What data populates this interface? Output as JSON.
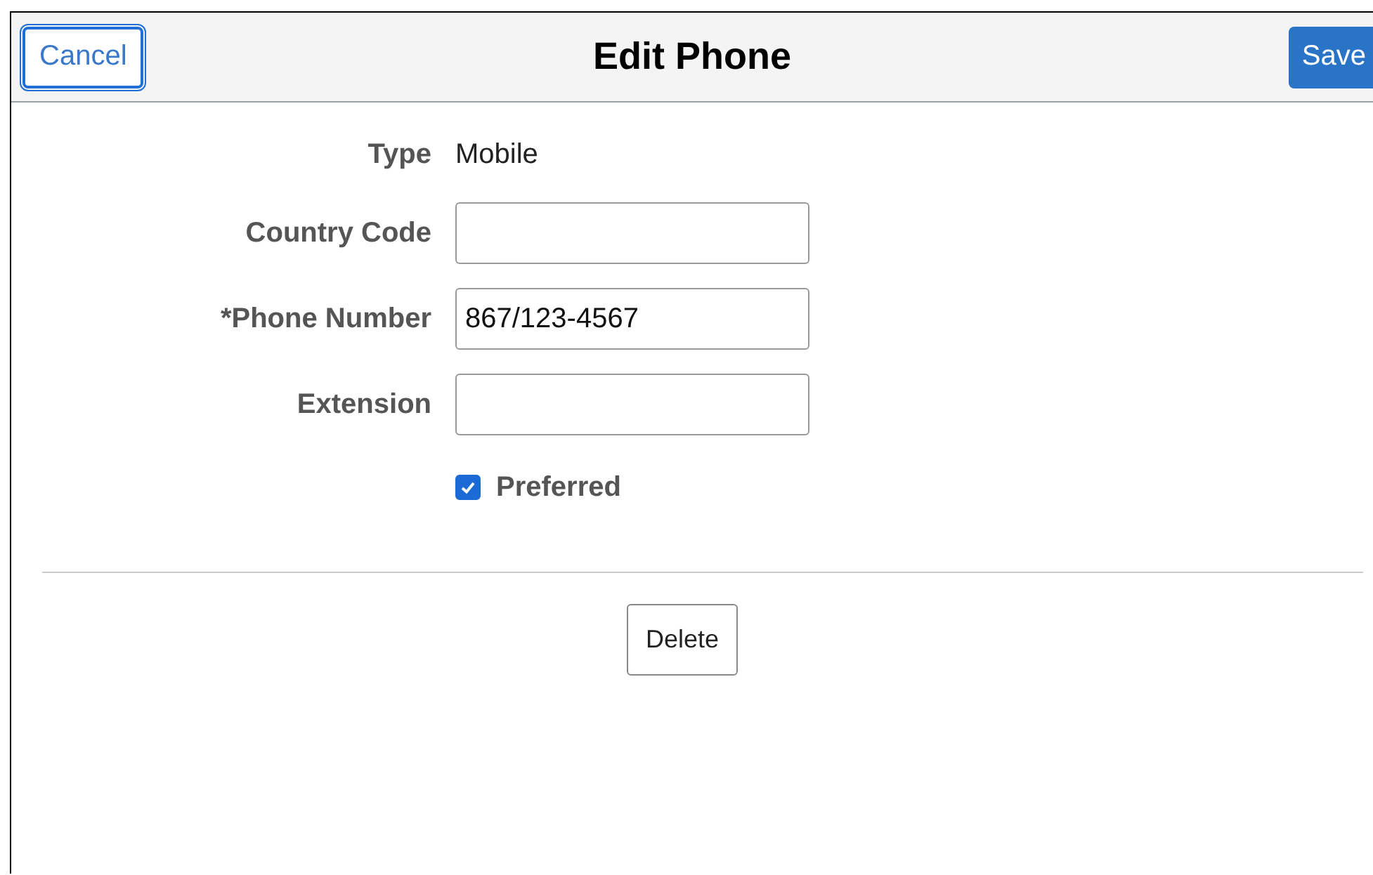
{
  "header": {
    "title": "Edit Phone",
    "cancel": "Cancel",
    "save": "Save"
  },
  "fields": [
    {
      "kind": "text",
      "label": "Type",
      "value": "Mobile"
    },
    {
      "kind": "input",
      "label": "Country Code"
    },
    {
      "kind": "input",
      "label": "*Phone Number",
      "value": "867/123-4567"
    },
    {
      "kind": "input",
      "label": "Extension"
    }
  ],
  "preferred": {
    "label": "Preferred",
    "checked": true
  },
  "delete_button": "Delete"
}
